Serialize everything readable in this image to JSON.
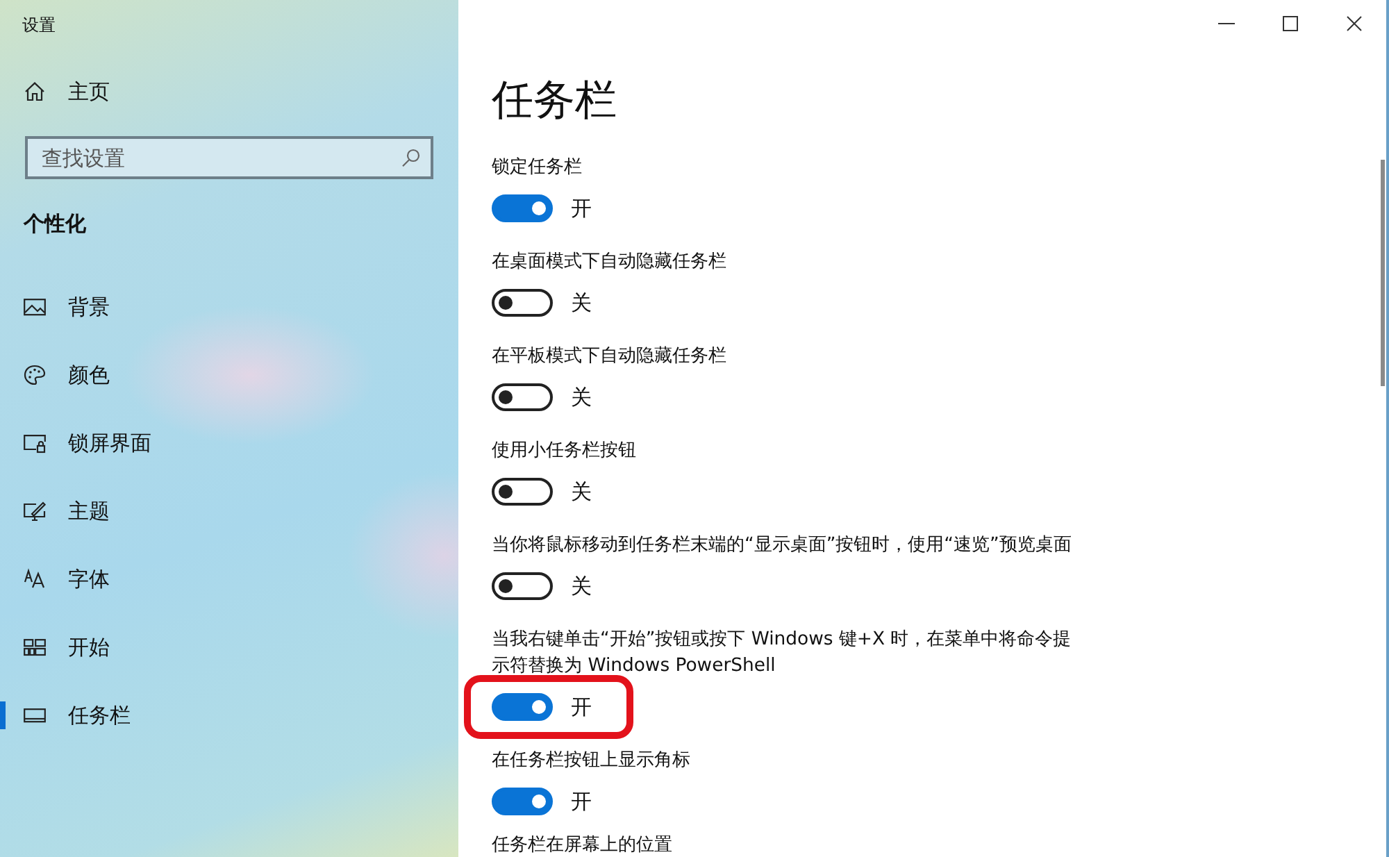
{
  "window": {
    "title": "设置",
    "controls": [
      {
        "kind": "minimize"
      },
      {
        "kind": "maximize"
      },
      {
        "kind": "close"
      }
    ]
  },
  "sidebar": {
    "home": {
      "label": "主页"
    },
    "search": {
      "placeholder": "查找设置"
    },
    "section": "个性化",
    "items": [
      {
        "kind": "picture",
        "label": "背景",
        "selected": false
      },
      {
        "kind": "palette",
        "label": "颜色",
        "selected": false
      },
      {
        "kind": "lockscreen",
        "label": "锁屏界面",
        "selected": false
      },
      {
        "kind": "theme",
        "label": "主题",
        "selected": false
      },
      {
        "kind": "font",
        "label": "字体",
        "selected": false
      },
      {
        "kind": "start",
        "label": "开始",
        "selected": false
      },
      {
        "kind": "taskbar",
        "label": "任务栏",
        "selected": true
      }
    ]
  },
  "page": {
    "title": "任务栏",
    "settings": [
      {
        "label": "锁定任务栏",
        "on": true,
        "state": "开",
        "highlighted": false
      },
      {
        "label": "在桌面模式下自动隐藏任务栏",
        "on": false,
        "state": "关",
        "highlighted": false
      },
      {
        "label": "在平板模式下自动隐藏任务栏",
        "on": false,
        "state": "关",
        "highlighted": false
      },
      {
        "label": "使用小任务栏按钮",
        "on": false,
        "state": "关",
        "highlighted": false
      },
      {
        "label": "当你将鼠标移动到任务栏末端的“显示桌面”按钮时，使用“速览”预览桌面",
        "on": false,
        "state": "关",
        "highlighted": false
      },
      {
        "label": "当我右键单击“开始”按钮或按下 Windows 键+X 时，在菜单中将命令提示符替换为 Windows PowerShell",
        "on": true,
        "state": "开",
        "highlighted": true
      },
      {
        "label": "在任务栏按钮上显示角标",
        "on": true,
        "state": "开",
        "highlighted": false
      },
      {
        "label": "任务栏在屏幕上的位置"
      }
    ]
  }
}
